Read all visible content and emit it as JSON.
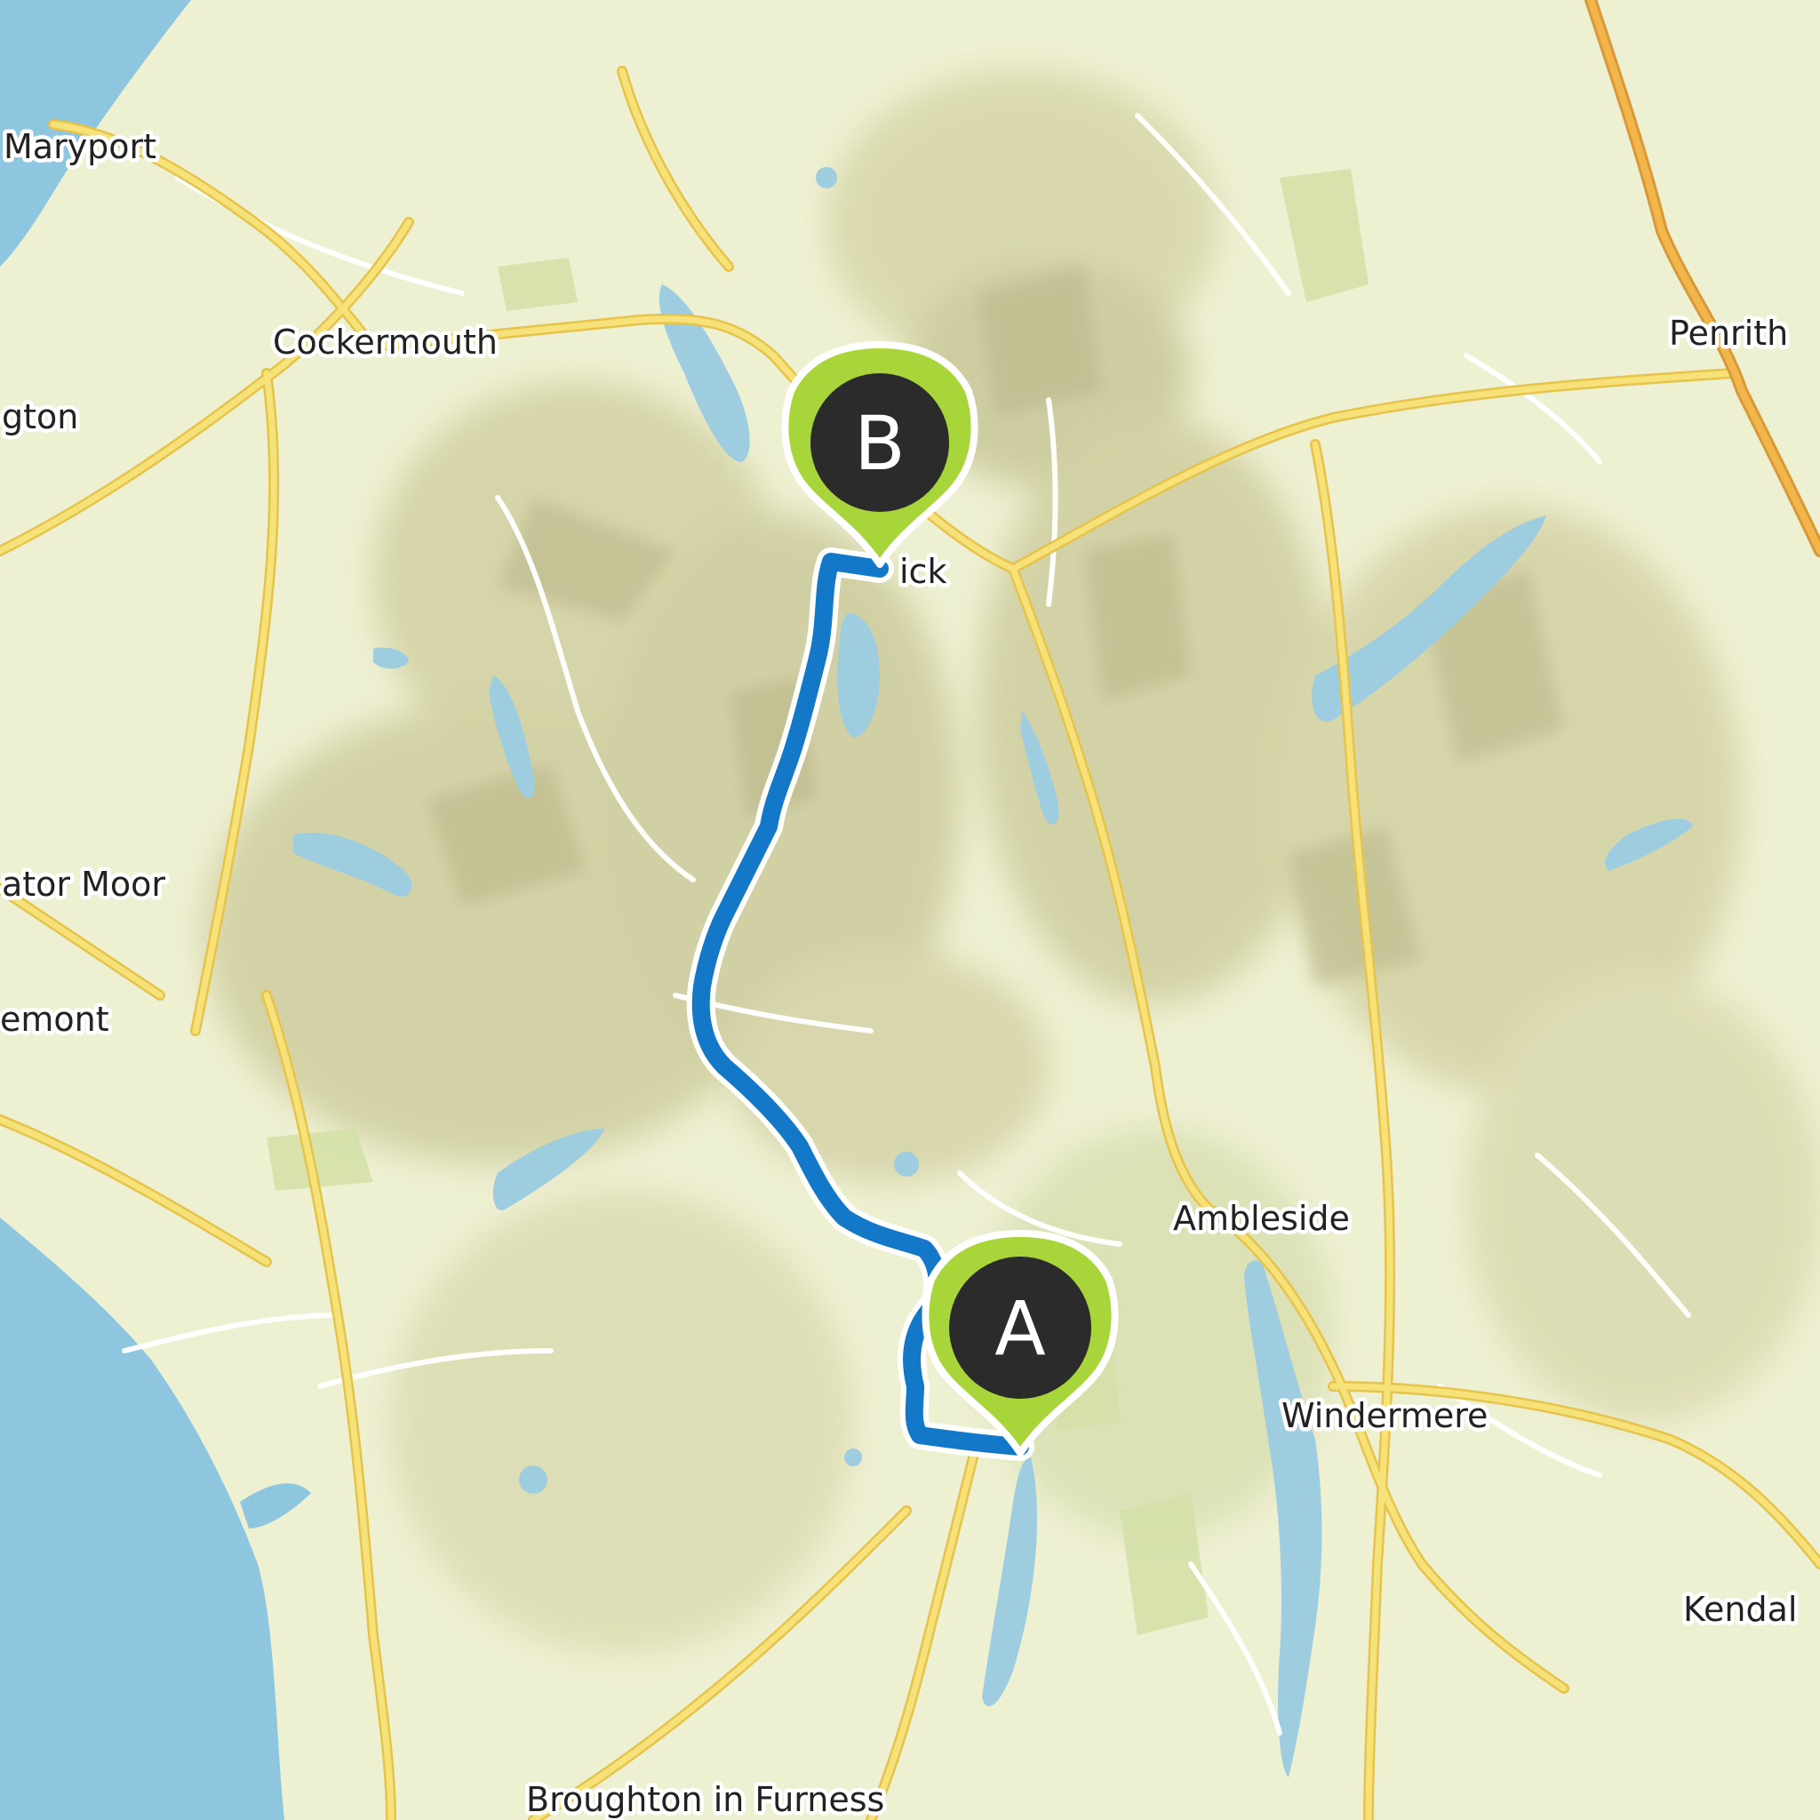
{
  "map": {
    "colors": {
      "land": "#eef0d2",
      "water": "#8fc6df",
      "lake": "#9fcde0",
      "relief_shadow": "#c9c79a",
      "relief_dark": "#b3b183",
      "woodland": "#d4e0a8",
      "road_major_fill": "#f7e27a",
      "road_major_casing": "#e6c34a",
      "motorway": "#f2b64a",
      "road_minor": "#ffffff",
      "route": "#1478c8",
      "route_casing": "#ffffff",
      "marker_pin": "#a8d63a",
      "marker_badge": "#2b2b2b",
      "label_text": "#222222"
    },
    "places": [
      {
        "id": "maryport",
        "name": "Maryport"
      },
      {
        "id": "cockermouth",
        "name": "Cockermouth"
      },
      {
        "id": "workington",
        "name": "gton"
      },
      {
        "id": "cleator-moor",
        "name": "ator Moor"
      },
      {
        "id": "egremont",
        "name": "emont"
      },
      {
        "id": "keswick",
        "name": "ick"
      },
      {
        "id": "penrith",
        "name": "Penrith"
      },
      {
        "id": "ambleside",
        "name": "Ambleside"
      },
      {
        "id": "windermere",
        "name": "Windermere"
      },
      {
        "id": "kendal",
        "name": "Kendal"
      },
      {
        "id": "broughton",
        "name": "Broughton in Furness"
      }
    ],
    "markers": {
      "start": {
        "letter": "A",
        "icon": "map-pin-start-icon"
      },
      "end": {
        "letter": "B",
        "icon": "map-pin-end-icon"
      }
    }
  }
}
